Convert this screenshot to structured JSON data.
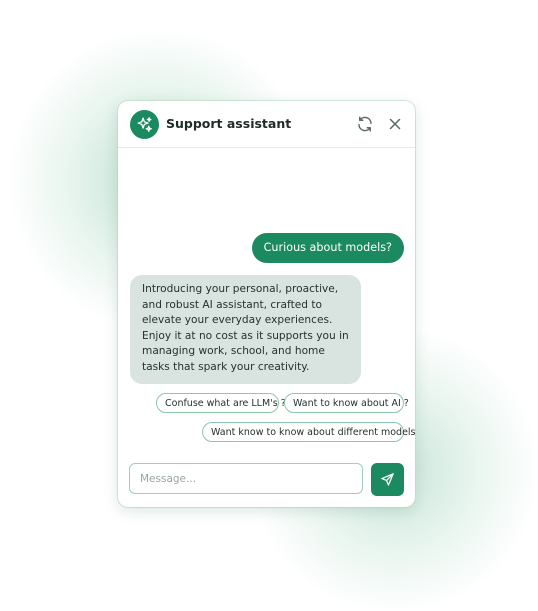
{
  "header": {
    "title": "Support assistant",
    "logo_icon": "sparkles-icon",
    "refresh_icon": "refresh-icon",
    "close_icon": "close-icon"
  },
  "conversation": {
    "user_message": "Curious about models?",
    "assistant_message": "Introducing your personal, proactive, and robust AI assistant, crafted to elevate your everyday experiences. Enjoy it at no cost as it supports you in managing work, school, and home tasks that spark your creativity."
  },
  "suggestions": [
    "Confuse what are LLM's ?",
    "Want to know about AI ?",
    "Want know to know about different models ?"
  ],
  "composer": {
    "placeholder": "Message...",
    "value": "",
    "send_icon": "send-icon"
  },
  "colors": {
    "accent": "#1b8a61",
    "assistant_bubble": "#d9e4e0",
    "chip_border": "#8cc7ab"
  }
}
